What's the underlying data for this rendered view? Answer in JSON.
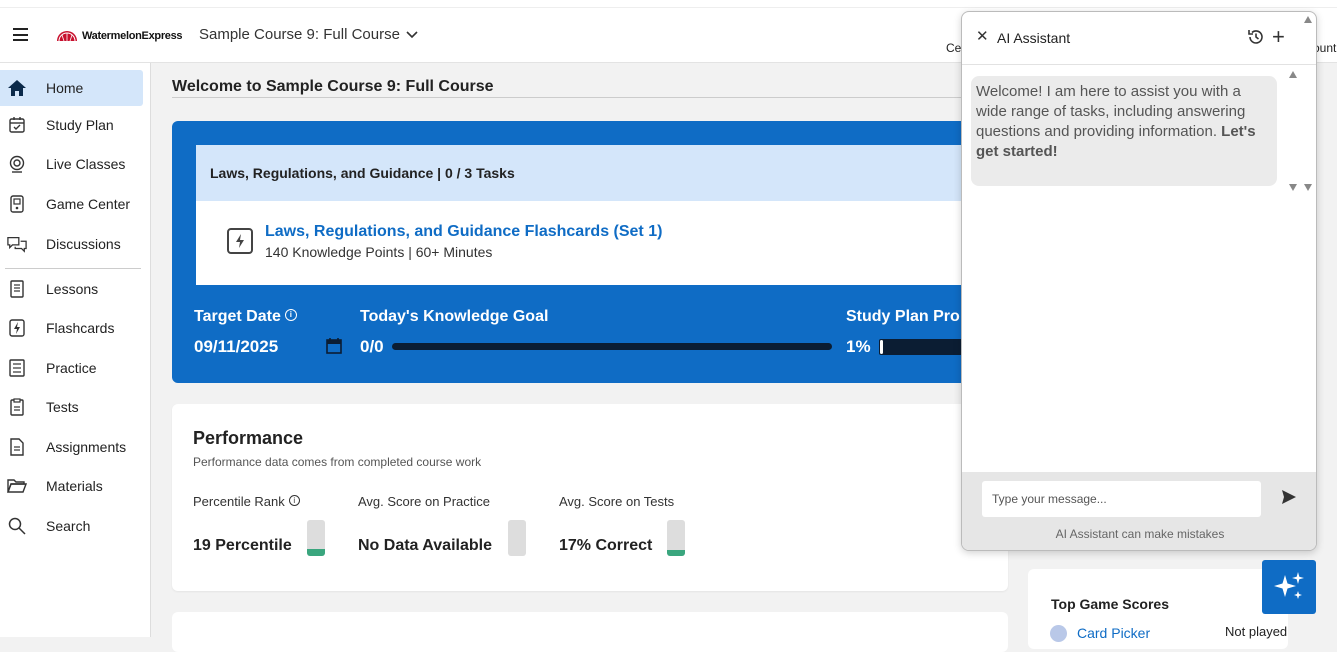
{
  "header": {
    "logo_text": "WatermelonExpress",
    "course_name": "Sample Course 9: Full Course",
    "peek_left": "Ce",
    "peek_right": "ount"
  },
  "sidebar": {
    "items": [
      {
        "label": "Home",
        "icon": "home-icon",
        "active": true
      },
      {
        "label": "Study Plan",
        "icon": "calendar-check-icon"
      },
      {
        "label": "Live Classes",
        "icon": "webcam-icon"
      },
      {
        "label": "Game Center",
        "icon": "game-console-icon"
      },
      {
        "label": "Discussions",
        "icon": "chat-bubbles-icon"
      },
      {
        "label": "Lessons",
        "icon": "book-icon"
      },
      {
        "label": "Flashcards",
        "icon": "flashcard-icon"
      },
      {
        "label": "Practice",
        "icon": "checklist-icon"
      },
      {
        "label": "Tests",
        "icon": "clipboard-icon"
      },
      {
        "label": "Assignments",
        "icon": "document-icon"
      },
      {
        "label": "Materials",
        "icon": "folder-icon"
      },
      {
        "label": "Search",
        "icon": "search-icon"
      }
    ]
  },
  "main": {
    "welcome_title": "Welcome to Sample Course 9: Full Course",
    "task_group": {
      "header": "Laws, Regulations, and Guidance | 0 / 3 Tasks",
      "task_title": "Laws, Regulations, and Guidance Flashcards (Set 1)",
      "task_sub": "140 Knowledge Points |  60+ Minutes"
    },
    "target_date": {
      "label": "Target Date",
      "value": "09/11/2025"
    },
    "knowledge_goal": {
      "label": "Today's Knowledge Goal",
      "value": "0/0",
      "progress": 0
    },
    "study_plan_progress": {
      "label": "Study Plan Pro",
      "value": "1%",
      "progress": 0.01
    },
    "performance": {
      "title": "Performance",
      "subtitle": "Performance data comes from completed course work",
      "metrics": [
        {
          "label": "Percentile Rank",
          "value": "19 Percentile",
          "fill": 0.19
        },
        {
          "label": "Avg. Score on Practice",
          "value": "No Data Available",
          "fill": 0
        },
        {
          "label": "Avg. Score on Tests",
          "value": "17% Correct",
          "fill": 0.17
        }
      ]
    },
    "top_game_scores": {
      "title": "Top Game Scores",
      "games": [
        {
          "name": "Card Picker",
          "status": "Not played"
        }
      ]
    }
  },
  "ai_assistant": {
    "title": "AI Assistant",
    "welcome_text": "Welcome! I am here to assist you with a wide range of tasks, including answering questions and providing information.",
    "welcome_bold": "Let's get started!",
    "input_placeholder": "Type your message...",
    "disclaimer": "AI Assistant can make mistakes"
  },
  "colors": {
    "accent": "#0f6cc5",
    "active_nav": "#d4e6fa",
    "gauge_fill": "#3aa67e"
  }
}
